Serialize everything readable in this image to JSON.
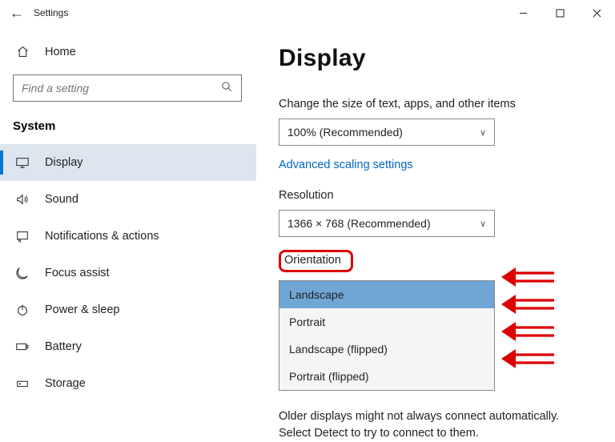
{
  "titlebar": {
    "title": "Settings"
  },
  "sidebar": {
    "home_label": "Home",
    "search_placeholder": "Find a setting",
    "group_label": "System",
    "items": [
      {
        "label": "Display"
      },
      {
        "label": "Sound"
      },
      {
        "label": "Notifications & actions"
      },
      {
        "label": "Focus assist"
      },
      {
        "label": "Power & sleep"
      },
      {
        "label": "Battery"
      },
      {
        "label": "Storage"
      }
    ]
  },
  "main": {
    "page_title": "Display",
    "scale_label": "Change the size of text, apps, and other items",
    "scale_value": "100% (Recommended)",
    "advanced_link": "Advanced scaling settings",
    "resolution_label": "Resolution",
    "resolution_value": "1366 × 768 (Recommended)",
    "orientation_label": "Orientation",
    "orientation_options": [
      "Landscape",
      "Portrait",
      "Landscape (flipped)",
      "Portrait (flipped)"
    ],
    "footnote": "Older displays might not always connect automatically. Select Detect to try to connect to them."
  }
}
